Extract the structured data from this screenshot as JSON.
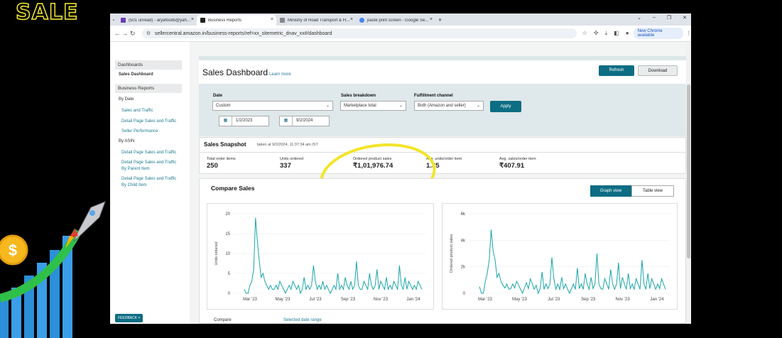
{
  "overlay": {
    "sale_text": "SALE"
  },
  "browser": {
    "tabs": [
      {
        "title": "(501 unread) - aryafoods@yah...",
        "active": false,
        "color": "#6a3fb0"
      },
      {
        "title": "Business Reports",
        "active": true,
        "color": "#222222"
      },
      {
        "title": "Ministry of Road Transport & H...",
        "active": false,
        "color": "#888888"
      },
      {
        "title": "paste print screen - Google Se...",
        "active": false,
        "color": "#4285f4"
      }
    ],
    "url": "sellercentral.amazon.in/business-reports/ref=xx_sitemetric_dnav_xx#/dashboard",
    "new_chrome": "New Chrome available"
  },
  "sidebar": {
    "dashboards_header": "Dashboards",
    "sales_dashboard": "Sales Dashboard",
    "business_reports_header": "Business Reports",
    "by_date": "By Date",
    "by_date_links": [
      "Sales and Traffic",
      "Detail Page Sales and Traffic",
      "Seller Performance"
    ],
    "by_asin": "By ASIN",
    "by_asin_links": [
      "Detail Page Sales and Traffic",
      "Detail Page Sales and Traffic By Parent Item",
      "Detail Page Sales and Traffic By Child Item"
    ],
    "feedback": "FEEDBACK ×"
  },
  "header": {
    "title": "Sales Dashboard",
    "learn_more": "Learn more",
    "refresh": "Refresh",
    "download": "Download"
  },
  "filters": {
    "date_label": "Date",
    "date_value": "Custom",
    "start_date": "1/2/2023",
    "end_date": "9/2/2024",
    "breakdown_label": "Sales breakdown",
    "breakdown_value": "Marketplace total",
    "fulfillment_label": "Fulfillment channel",
    "fulfillment_value": "Both (Amazon and seller)",
    "apply": "Apply"
  },
  "snapshot": {
    "title": "Sales Snapshot",
    "timestamp": "taken at 9/2/2024, 11:37:34 am IST",
    "metrics": [
      {
        "label": "Total order items",
        "value": "250"
      },
      {
        "label": "Units ordered",
        "value": "337"
      },
      {
        "label": "Ordered product sales",
        "value": "₹1,01,976.74"
      },
      {
        "label": "Avg. units/order item",
        "value": "1.35"
      },
      {
        "label": "Avg. sales/order item",
        "value": "₹407.91"
      }
    ]
  },
  "compare": {
    "title": "Compare Sales",
    "graph_view": "Graph view",
    "table_view": "Table view",
    "bottom_label": "Compare",
    "bottom_link": "Selected date range"
  },
  "chart_data": [
    {
      "type": "line",
      "title": "",
      "xlabel": "",
      "ylabel": "Units ordered",
      "ylim": [
        0,
        20
      ],
      "yticks": [
        0,
        5,
        10,
        15,
        20
      ],
      "xticks": [
        "Mar '23",
        "May '23",
        "Jul '23",
        "Sep '23",
        "Nov '23",
        "Jan '24"
      ],
      "series": [
        {
          "values": [
            1,
            0,
            0,
            2,
            3,
            6,
            19,
            13,
            8,
            4,
            5,
            3,
            2,
            1,
            2,
            1,
            1,
            2,
            1,
            3,
            2,
            1,
            0,
            1,
            2,
            1,
            3,
            2,
            1,
            2,
            0,
            1,
            4,
            1,
            2,
            1,
            2,
            7,
            3,
            1,
            2,
            1,
            3,
            1,
            2,
            1,
            0,
            1,
            2,
            1,
            5,
            1,
            2,
            1,
            4,
            2,
            1,
            3,
            1,
            2,
            8,
            2,
            1,
            1,
            3,
            2,
            1,
            5,
            2,
            1,
            2,
            6,
            1,
            3,
            2,
            1,
            4,
            1,
            2,
            1,
            3,
            2,
            1,
            7,
            2,
            1,
            4,
            1,
            3,
            2,
            1,
            2,
            1,
            3,
            2,
            1
          ]
        }
      ],
      "color": "#1aa5a8"
    },
    {
      "type": "line",
      "title": "",
      "xlabel": "",
      "ylabel": "Ordered product sales",
      "ylim": [
        0,
        6000
      ],
      "yticks": [
        "0",
        "2k",
        "4k",
        "6k"
      ],
      "xticks": [
        "Mar '23",
        "May '23",
        "Jul '23",
        "Sep '23",
        "Nov '23",
        "Jan '24"
      ],
      "series": [
        {
          "values": [
            500,
            0,
            0,
            900,
            1500,
            2500,
            4800,
            3200,
            2500,
            1200,
            1500,
            900,
            600,
            400,
            700,
            300,
            350,
            700,
            400,
            900,
            600,
            300,
            0,
            400,
            800,
            350,
            1100,
            700,
            300,
            600,
            0,
            350,
            1600,
            300,
            700,
            350,
            700,
            2700,
            1100,
            300,
            700,
            300,
            1200,
            350,
            700,
            300,
            0,
            350,
            700,
            300,
            1900,
            350,
            700,
            300,
            1500,
            700,
            300,
            1200,
            350,
            700,
            3000,
            700,
            350,
            300,
            1100,
            700,
            300,
            1800,
            700,
            300,
            700,
            2300,
            350,
            1200,
            700,
            300,
            1500,
            350,
            700,
            300,
            1100,
            700,
            300,
            2500,
            700,
            300,
            1500,
            350,
            1100,
            700,
            300,
            700,
            350,
            1100,
            700,
            300
          ]
        }
      ],
      "color": "#1aa5a8"
    }
  ]
}
